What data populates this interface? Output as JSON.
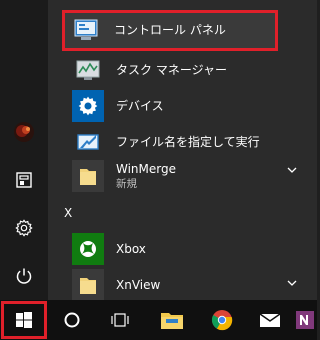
{
  "start_menu": {
    "items": [
      {
        "label": "コントロール パネル",
        "icon": "control-panel-icon"
      },
      {
        "label": "タスク マネージャー",
        "icon": "task-manager-icon"
      },
      {
        "label": "デバイス",
        "icon": "gear-icon"
      },
      {
        "label": "ファイル名を指定して実行",
        "icon": "run-icon"
      }
    ],
    "groups": [
      {
        "label": "WinMerge",
        "sublabel": "新規",
        "icon": "folder-icon"
      },
      {
        "label": "Xbox",
        "icon": "xbox-icon"
      },
      {
        "label": "XnView",
        "icon": "folder-icon"
      }
    ],
    "section_letter": "X"
  },
  "left_rail": [
    {
      "icon": "user-avatar-icon"
    },
    {
      "icon": "documents-icon"
    },
    {
      "icon": "settings-icon"
    },
    {
      "icon": "power-icon"
    }
  ],
  "taskbar": [
    {
      "icon": "windows-start-icon"
    },
    {
      "icon": "cortana-circle-icon"
    },
    {
      "icon": "task-view-icon"
    },
    {
      "icon": "file-explorer-icon"
    },
    {
      "icon": "chrome-icon"
    },
    {
      "icon": "mail-icon"
    },
    {
      "icon": "onenote-icon"
    }
  ],
  "colors": {
    "highlight_box": "#e0202a",
    "tile_blue": "#0063b1",
    "tile_green": "#107c10",
    "folder": "#f2d37b"
  }
}
